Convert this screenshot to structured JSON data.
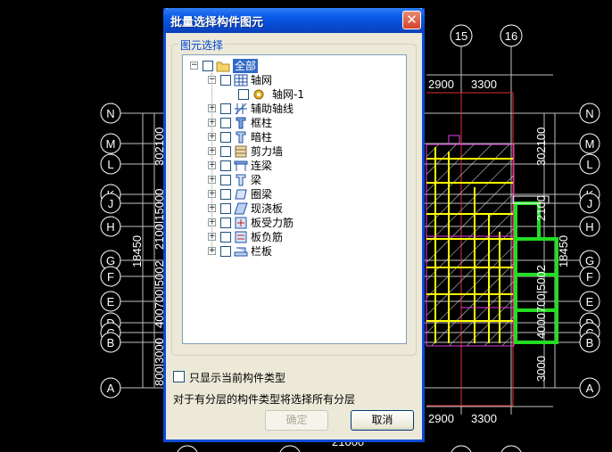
{
  "dialog": {
    "title": "批量选择构件图元",
    "close_glyph": "✕",
    "group_label": "图元选择",
    "tree": [
      {
        "label": "全部",
        "level": 0,
        "expander": "−",
        "icon": "folder-icon",
        "selected": true
      },
      {
        "label": "轴网",
        "level": 1,
        "expander": "−",
        "icon": "grid-icon"
      },
      {
        "label": "轴网-1",
        "level": 2,
        "expander": "",
        "icon": "gear-icon"
      },
      {
        "label": "辅助轴线",
        "level": 1,
        "expander": "+",
        "icon": "aux-axis-icon"
      },
      {
        "label": "框柱",
        "level": 1,
        "expander": "+",
        "icon": "column-icon"
      },
      {
        "label": "暗柱",
        "level": 1,
        "expander": "+",
        "icon": "hidden-column-icon"
      },
      {
        "label": "剪力墙",
        "level": 1,
        "expander": "+",
        "icon": "shear-wall-icon"
      },
      {
        "label": "连梁",
        "level": 1,
        "expander": "+",
        "icon": "link-beam-icon"
      },
      {
        "label": "梁",
        "level": 1,
        "expander": "+",
        "icon": "beam-icon"
      },
      {
        "label": "圈梁",
        "level": 1,
        "expander": "+",
        "icon": "ring-beam-icon"
      },
      {
        "label": "现浇板",
        "level": 1,
        "expander": "+",
        "icon": "slab-icon"
      },
      {
        "label": "板受力筋",
        "level": 1,
        "expander": "+",
        "icon": "slab-rebar-icon"
      },
      {
        "label": "板负筋",
        "level": 1,
        "expander": "+",
        "icon": "slab-neg-rebar-icon"
      },
      {
        "label": "栏板",
        "level": 1,
        "expander": "+",
        "icon": "parapet-icon"
      }
    ],
    "only_current_label": "只显示当前构件类型",
    "note": "对于有分层的构件类型将选择所有分层",
    "ok_label": "确定",
    "cancel_label": "取消"
  },
  "cad": {
    "top_axes": [
      "15",
      "16"
    ],
    "left_axes": [
      "N",
      "M",
      "L",
      "K",
      "J",
      "H",
      "G",
      "F",
      "E",
      "D",
      "C",
      "B",
      "A"
    ],
    "right_axes": [
      "N",
      "M",
      "L",
      "K",
      "J",
      "H",
      "G",
      "F",
      "E",
      "D",
      "C",
      "B",
      "A"
    ],
    "top_dims": [
      "2900",
      "3300"
    ],
    "bottom_dims": [
      "2900",
      "3300"
    ],
    "bottom_partial": "21000",
    "left_total": "18450",
    "right_total": "18450",
    "left_dim_upper": "302100",
    "left_dim_mid": "2100|15000",
    "left_dim_lower": "400700|5002",
    "left_dim_bottom": "800|3000",
    "right_dim_upper": "302100",
    "right_dim_mid": "2100",
    "right_dim_lower": "4000700|5002",
    "right_dim_bottom": "3000"
  }
}
